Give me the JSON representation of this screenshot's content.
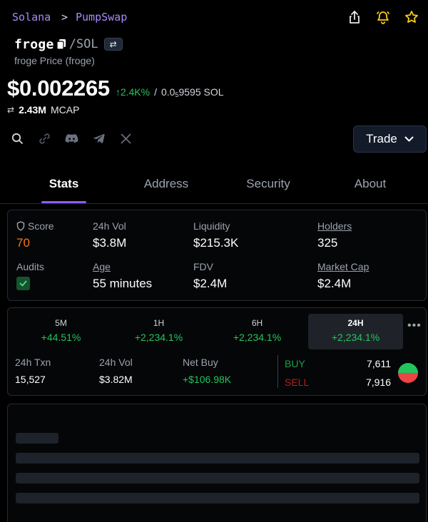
{
  "breadcrumb": {
    "network": "Solana",
    "separator": ">",
    "dex": "PumpSwap"
  },
  "token": {
    "symbol": "froge",
    "pair": "/SOL",
    "swap_chip": "⇄",
    "subtitle": "froge Price (froge)",
    "price": "$0.002265",
    "change": "↑2.4K%",
    "slash": "/",
    "sol_price_prefix": "0.0",
    "sol_price_sub": "5",
    "sol_price_rest": "9595 SOL",
    "mcap_swap": "⇄",
    "mcap_value": "2.43M",
    "mcap_label": "MCAP"
  },
  "trade_button": {
    "label": "Trade"
  },
  "tabs": [
    "Stats",
    "Address",
    "Security",
    "About"
  ],
  "stats": {
    "score": {
      "label": "Score",
      "value": "70"
    },
    "vol24h": {
      "label": "24h Vol",
      "value": "$3.8M"
    },
    "liquidity": {
      "label": "Liquidity",
      "value": "$215.3K"
    },
    "holders": {
      "label": "Holders",
      "value": "325"
    },
    "audits": {
      "label": "Audits"
    },
    "age": {
      "label": "Age",
      "value": "55 minutes"
    },
    "fdv": {
      "label": "FDV",
      "value": "$2.4M"
    },
    "market_cap": {
      "label": "Market Cap",
      "value": "$2.4M"
    }
  },
  "timeframes": [
    {
      "name": "5M",
      "change": "+44.51%"
    },
    {
      "name": "1H",
      "change": "+2,234.1%"
    },
    {
      "name": "6H",
      "change": "+2,234.1%"
    },
    {
      "name": "24H",
      "change": "+2,234.1%"
    }
  ],
  "more_label": "•••",
  "txn": {
    "txn24h": {
      "label": "24h Txn",
      "value": "15,527"
    },
    "vol24h": {
      "label": "24h Vol",
      "value": "$3.82M"
    },
    "net_buy": {
      "label": "Net Buy",
      "value": "+$106.98K"
    },
    "buy": {
      "label": "BUY",
      "count": "7,611"
    },
    "sell": {
      "label": "SELL",
      "count": "7,916"
    }
  },
  "colors": {
    "accent": "#8b5cf6",
    "up": "#22c55e",
    "down": "#ef4444",
    "score": "#f97316"
  },
  "icons": {
    "top": [
      "share-icon",
      "bell-icon",
      "star-icon"
    ],
    "social": [
      "search-icon",
      "link-icon",
      "discord-icon",
      "telegram-icon",
      "x-icon"
    ]
  }
}
